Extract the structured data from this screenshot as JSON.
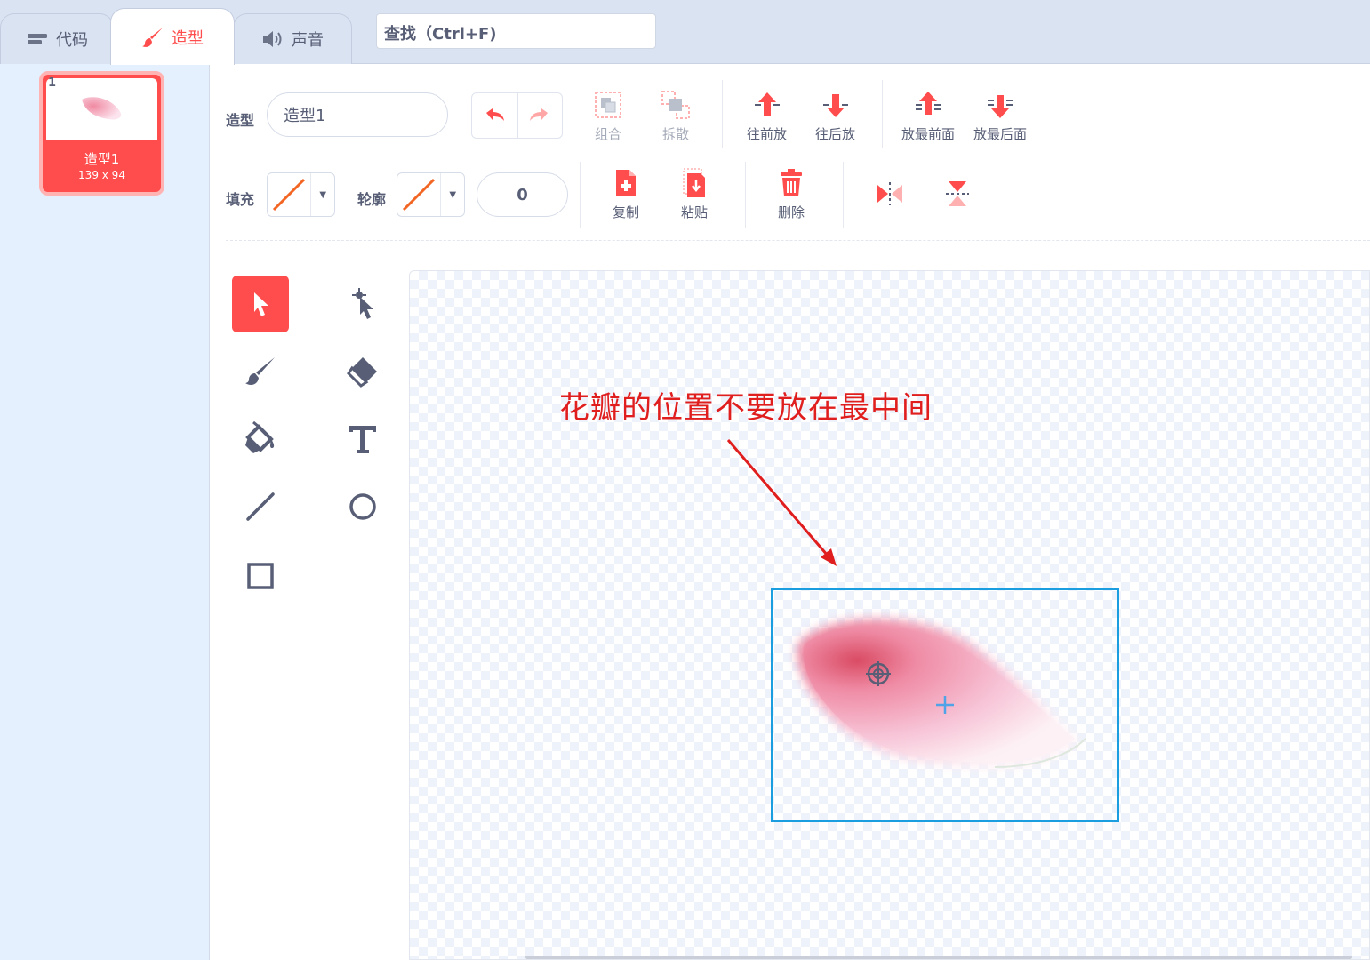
{
  "tabs": [
    {
      "label": "代码",
      "icon": "code-icon"
    },
    {
      "label": "造型",
      "icon": "brush-icon"
    },
    {
      "label": "声音",
      "icon": "speaker-icon"
    }
  ],
  "search": {
    "placeholder": "查找（Ctrl+F)"
  },
  "costume_list": [
    {
      "index": "1",
      "name": "造型1",
      "size": "139 x 94"
    }
  ],
  "toolbar": {
    "costume_label": "造型",
    "costume_name": "造型1",
    "fill_label": "填充",
    "outline_label": "轮廓",
    "outline_width": "0",
    "group": "组合",
    "ungroup": "拆散",
    "forward": "往前放",
    "backward": "往后放",
    "front": "放最前面",
    "back": "放最后面",
    "copy": "复制",
    "paste": "粘贴",
    "delete": "删除"
  },
  "canvas": {
    "annotation": "花瓣的位置不要放在最中间"
  },
  "colors": {
    "accent": "#ff4c4c",
    "annotation": "#e01e1e",
    "selection": "#1a9ee0",
    "tool_icon": "#575e75"
  }
}
